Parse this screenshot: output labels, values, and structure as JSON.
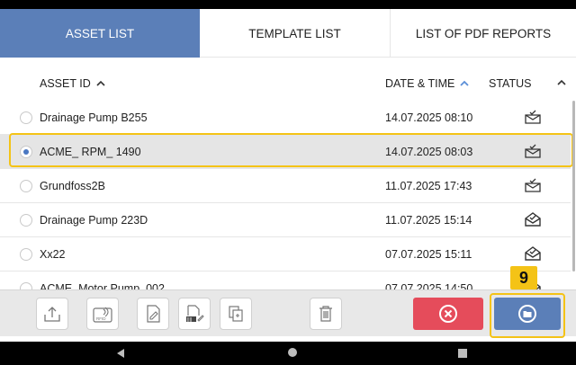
{
  "tabs": [
    {
      "label": "ASSET LIST",
      "active": true
    },
    {
      "label": "TEMPLATE LIST",
      "active": false
    },
    {
      "label": "LIST OF PDF REPORTS",
      "active": false
    }
  ],
  "table": {
    "headers": {
      "asset_id": "ASSET ID",
      "date_time": "DATE & TIME",
      "status": "STATUS"
    },
    "rows": [
      {
        "asset_id": "Drainage Pump B255",
        "date_time": "14.07.2025 08:10",
        "status_icon": "mail-check-icon",
        "selected": false
      },
      {
        "asset_id": "ACME_ RPM_ 1490",
        "date_time": "14.07.2025 08:03",
        "status_icon": "mail-check-icon",
        "selected": true
      },
      {
        "asset_id": "Grundfoss2B",
        "date_time": "11.07.2025 17:43",
        "status_icon": "mail-check-icon",
        "selected": false
      },
      {
        "asset_id": "Drainage Pump 223D",
        "date_time": "11.07.2025 15:14",
        "status_icon": "mail-open-icon",
        "selected": false
      },
      {
        "asset_id": "Xx22",
        "date_time": "07.07.2025 15:11",
        "status_icon": "mail-open-icon",
        "selected": false
      },
      {
        "asset_id": "ACME_Motor Pump_002",
        "date_time": "07.07.2025 14:50",
        "status_icon": "mail-open-icon",
        "selected": false
      }
    ]
  },
  "toolbar": {
    "rfid_label": "RFID",
    "barcode_label": "||||"
  },
  "annotation": {
    "step": "9"
  },
  "colors": {
    "accent": "#5b7fb8",
    "cancel": "#e54c5b",
    "highlight": "#f4c316"
  }
}
